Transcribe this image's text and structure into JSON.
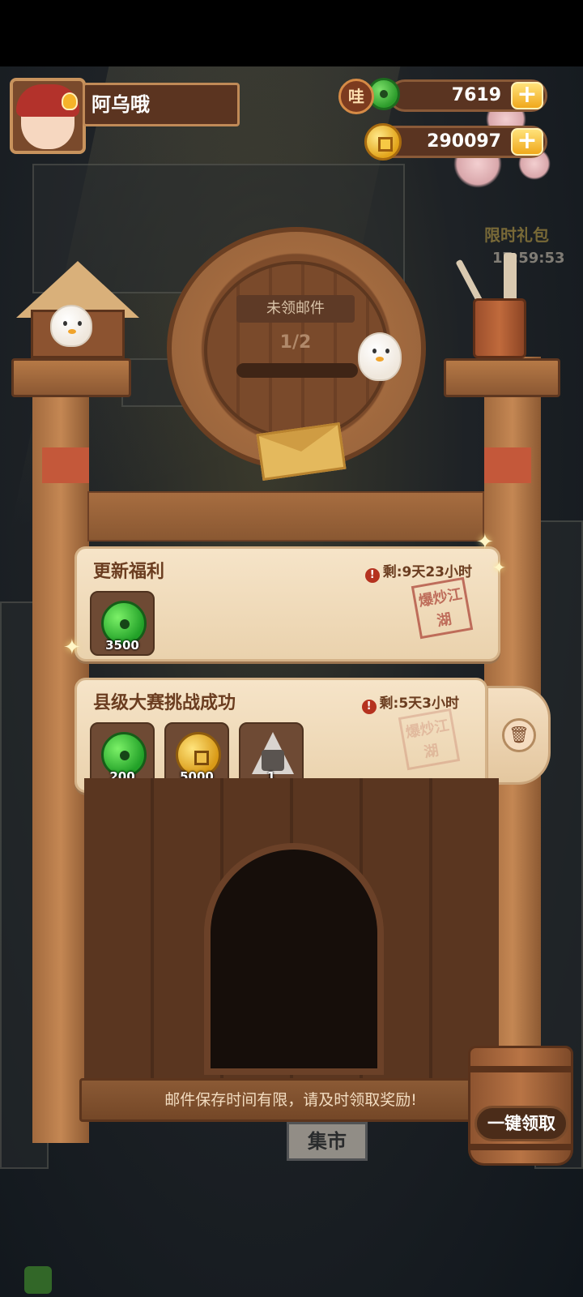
{
  "header": {
    "player_name": "阿乌哦",
    "jade_label": "哇",
    "jade_amount": "7619",
    "gold_amount": "290097",
    "plus_symbol": "+"
  },
  "background": {
    "limited_pack_label": "限时礼包",
    "limited_pack_timer": "17:59:53",
    "market_sign": "集市"
  },
  "mailbox": {
    "title": "未领邮件",
    "count": "1/2",
    "progress_fraction": 0.5,
    "notice": "邮件保存时间有限，请及时领取奖励!",
    "collect_all_label": "一键领取"
  },
  "mails": [
    {
      "title": "更新福利",
      "expiry": "剩:9天23小时",
      "stamp": "爆炒江湖",
      "items": [
        {
          "type": "jade-icon",
          "qty": "3500"
        }
      ]
    },
    {
      "title": "县级大赛挑战成功",
      "expiry": "剩:5天3小时",
      "stamp": "爆炒江湖",
      "items": [
        {
          "type": "jade-icon",
          "qty": "200"
        },
        {
          "type": "gold-coin-icon",
          "qty": "5000"
        },
        {
          "type": "rice-ball-icon",
          "qty": "1"
        }
      ]
    }
  ],
  "icons": {
    "warning": "!",
    "delete": "🗑"
  },
  "colors": {
    "card_bg": "#f6e4c8",
    "wood": "#8c5833",
    "accent_gold": "#f0a81c",
    "warn_red": "#b5321f"
  }
}
